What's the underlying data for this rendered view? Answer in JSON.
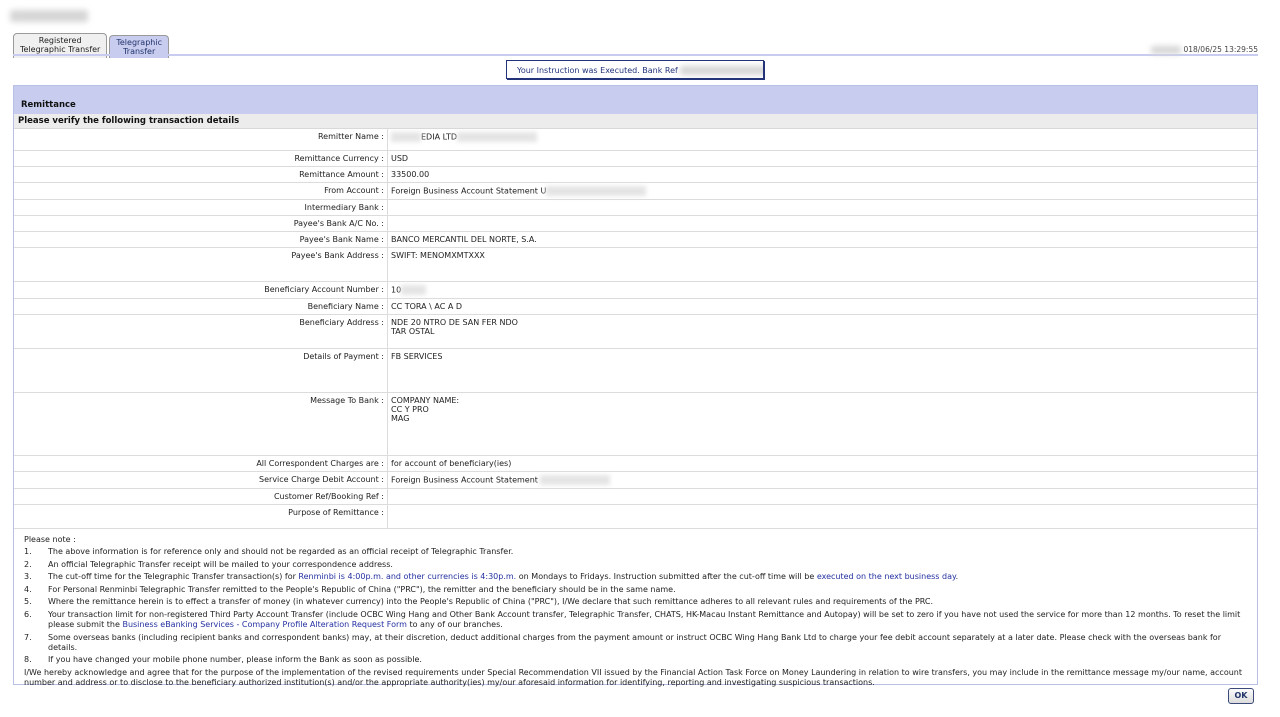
{
  "tabs": [
    {
      "label_line1": "Registered",
      "label_line2": "Telegraphic Transfer"
    },
    {
      "label_line1": "Telegraphic",
      "label_line2": "Transfer"
    }
  ],
  "timestamp": "018/06/25 13:29:55",
  "execution_message": "Your Instruction was Executed. Bank Ref",
  "panel_title": "Remittance",
  "subtitle": "Please verify the following transaction details",
  "fields": [
    {
      "label": "Remitter Name :",
      "value": "EDIA LTD"
    },
    {
      "label": "Remittance Currency :",
      "value": "USD"
    },
    {
      "label": "Remittance Amount :",
      "value": "33500.00"
    },
    {
      "label": "From Account :",
      "value": "Foreign Business Account Statement U"
    },
    {
      "label": "Intermediary Bank :",
      "value": ""
    },
    {
      "label": "Payee's Bank A/C No. :",
      "value": ""
    },
    {
      "label": "Payee's Bank Name :",
      "value": "BANCO MERCANTIL DEL NORTE, S.A."
    },
    {
      "label": "Payee's Bank Address :",
      "value": "SWIFT: MENOMXMTXXX"
    },
    {
      "label": "Beneficiary Account Number :",
      "value": "10"
    },
    {
      "label": "Beneficiary Name :",
      "value": "CC      TORA \\            AC   A D"
    },
    {
      "label": "Beneficiary Address :",
      "value": "NDE 20    NTRO DE SAN FER     NDO",
      "value2": "TAR  OSTAL"
    },
    {
      "label": "Details of Payment :",
      "value": "FB SERVICES"
    },
    {
      "label": "Message To Bank :",
      "value": "COMPANY NAME:",
      "value2": "CC            Y PRO",
      "value3": "MAG"
    },
    {
      "label": "All Correspondent Charges are :",
      "value": "for account of beneficiary(ies)"
    },
    {
      "label": "Service Charge Debit Account :",
      "value": "Foreign Business Account Statement"
    },
    {
      "label": "Customer Ref/Booking Ref :",
      "value": ""
    },
    {
      "label": "Purpose of Remittance :",
      "value": ""
    }
  ],
  "notes": {
    "heading": "Please note :",
    "items": [
      {
        "num": "1.",
        "text": "The above information is for reference only and should not be regarded as an official receipt of Telegraphic Transfer."
      },
      {
        "num": "2.",
        "text": "An official Telegraphic Transfer receipt will be mailed to your correspondence address."
      },
      {
        "num": "3.",
        "pre": "The cut-off time for the Telegraphic Transfer transaction(s) for ",
        "link1": "Renminbi is 4:00p.m. and other currencies is 4:30p.m.",
        "mid": " on Mondays to Fridays. Instruction submitted after the cut-off time will be ",
        "link2": "executed on the next business day",
        "post": "."
      },
      {
        "num": "4.",
        "text": "For Personal Renminbi Telegraphic Transfer remitted to the People's Republic of China (\"PRC\"), the remitter and the beneficiary should be in the same name."
      },
      {
        "num": "5.",
        "text": "Where the remittance herein is to effect a transfer of money (in whatever currency) into the People's Republic of China (\"PRC\"), I/We declare that such remittance adheres to all relevant rules and requirements of the PRC."
      },
      {
        "num": "6.",
        "pre": "Your transaction limit for non-registered Third Party Account Transfer (include OCBC Wing Hang and Other Bank Account transfer, Telegraphic Transfer, CHATS, HK-Macau Instant Remittance and Autopay) will be set to zero if you have not used the service for more than 12 months. To reset the limit please submit the ",
        "link1": "Business eBanking Services - Company Profile Alteration Request Form",
        "post": " to any of our branches."
      },
      {
        "num": "7.",
        "text": "Some overseas banks (including recipient banks and correspondent banks) may, at their discretion, deduct additional charges from the payment amount or instruct OCBC Wing Hang Bank Ltd to charge your fee debit account separately at a later date. Please check with the overseas bank for details."
      },
      {
        "num": "8.",
        "text": "If you have changed your mobile phone number, please inform the Bank as soon as possible."
      }
    ],
    "declaration": "I/We hereby acknowledge and agree that for the purpose of the implementation of the revised requirements under Special Recommendation VII issued by the Financial Action Task Force on Money Laundering in relation to wire transfers, you may include in the remittance message my/our name, account number and address or to disclose to the beneficiary authorized institution(s) and/or the appropriate authority(ies) my/our aforesaid information for identifying, reporting and investigating suspicious transactions."
  },
  "ok_button": "OK",
  "colors": {
    "accent": "#c8cdf0",
    "link": "#2330a0",
    "border": "#22337a"
  }
}
